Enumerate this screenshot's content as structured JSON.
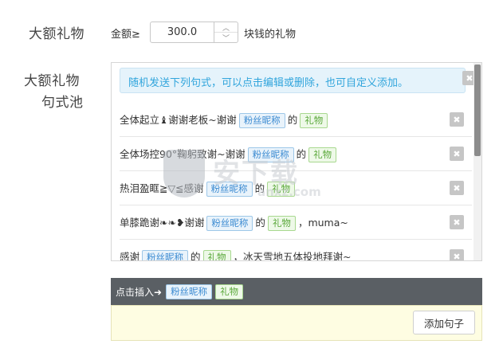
{
  "labels": {
    "big_gift": "大额礼物",
    "pool_line1": "大额礼物",
    "pool_line2": "句式池"
  },
  "amount": {
    "prefix": "金额≥",
    "value": "300.0",
    "suffix": "块钱的礼物",
    "up_glyph": "︿",
    "down_glyph": "﹀"
  },
  "pool": {
    "notice": "随机发送下列句式，可以点击编辑或删除，也可自定义添加。",
    "close_glyph": "✖",
    "rows": [
      {
        "parts": [
          {
            "t": "text",
            "v": "全体起立♝谢谢老板~谢谢"
          },
          {
            "t": "fan",
            "v": "粉丝昵称"
          },
          {
            "t": "text",
            "v": "的"
          },
          {
            "t": "gift",
            "v": "礼物"
          }
        ]
      },
      {
        "parts": [
          {
            "t": "text",
            "v": "全体场控90°鞠躬致谢~谢谢"
          },
          {
            "t": "fan",
            "v": "粉丝昵称"
          },
          {
            "t": "text",
            "v": "的"
          },
          {
            "t": "gift",
            "v": "礼物"
          }
        ]
      },
      {
        "parts": [
          {
            "t": "text",
            "v": "热泪盈眶≧▽≦感谢"
          },
          {
            "t": "fan",
            "v": "粉丝昵称"
          },
          {
            "t": "text",
            "v": "的"
          },
          {
            "t": "gift",
            "v": "礼物"
          }
        ]
      },
      {
        "parts": [
          {
            "t": "text",
            "v": "单膝跪谢❧❧❥谢谢"
          },
          {
            "t": "fan",
            "v": "粉丝昵称"
          },
          {
            "t": "text",
            "v": "的"
          },
          {
            "t": "gift",
            "v": "礼物"
          },
          {
            "t": "text",
            "v": "，muma~"
          }
        ]
      },
      {
        "parts": [
          {
            "t": "text",
            "v": "感谢"
          },
          {
            "t": "fan",
            "v": "粉丝昵称"
          },
          {
            "t": "text",
            "v": "的"
          },
          {
            "t": "gift",
            "v": "礼物"
          },
          {
            "t": "text",
            "v": "，冰天雪地五体投地拜谢~"
          }
        ]
      }
    ],
    "delete_glyph": "✖"
  },
  "insert": {
    "label": "点击插入➜",
    "fan_tag": "粉丝昵称",
    "gift_tag": "礼物"
  },
  "add": {
    "button_label": "添加句子"
  },
  "watermark": {
    "text": "安下载",
    "sub": "anxz.com"
  }
}
